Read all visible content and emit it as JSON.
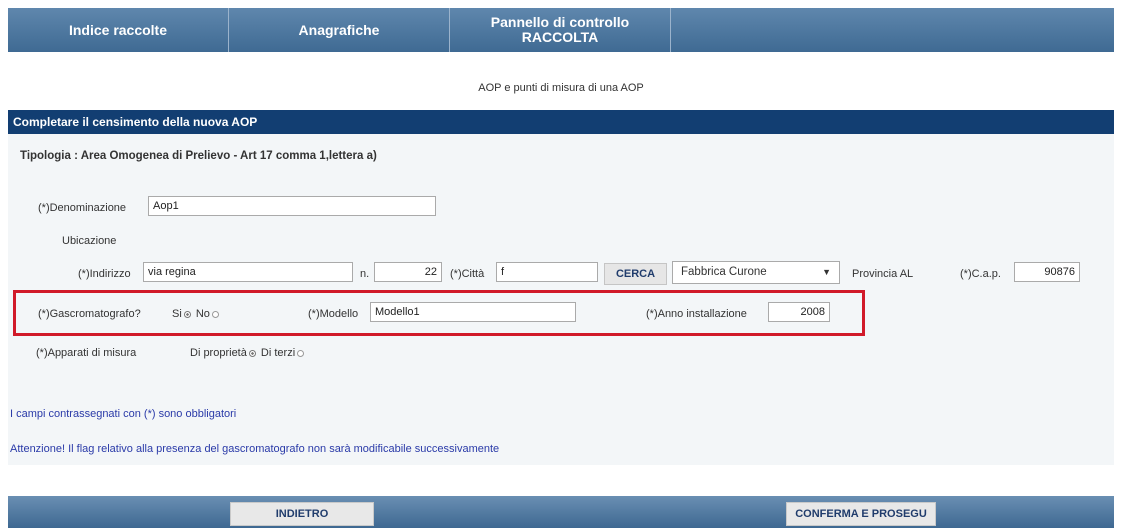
{
  "nav": {
    "tabs": [
      {
        "label": "Indice raccolte"
      },
      {
        "label": "Anagrafiche"
      },
      {
        "label_line1": "Pannello di controllo",
        "label_line2": "RACCOLTA"
      }
    ]
  },
  "page": {
    "subtitle": "AOP e punti di misura di una AOP"
  },
  "form": {
    "header": "Completare il censimento della nuova AOP",
    "tipologia": "Tipologia : Area Omogenea di Prelievo - Art 17 comma 1,lettera a)",
    "denominazione": {
      "label": "(*)Denominazione",
      "value": "Aop1"
    },
    "ubicazione_label": "Ubicazione",
    "indirizzo": {
      "label": "(*)Indirizzo",
      "value": "via regina"
    },
    "numero": {
      "label": "n.",
      "value": "22"
    },
    "citta": {
      "label": "(*)Città",
      "value": "f"
    },
    "cerca_label": "CERCA",
    "comune_select": {
      "value": "Fabbrica Curone"
    },
    "provincia": "Provincia AL",
    "cap": {
      "label": "(*)C.a.p.",
      "value": "90876"
    },
    "gascromatografo": {
      "label": "(*)Gascromatografo?",
      "si": "Si",
      "no": "No",
      "selected": "Si"
    },
    "modello": {
      "label": "(*)Modello",
      "value": "Modello1"
    },
    "anno": {
      "label": "(*)Anno installazione",
      "value": "2008"
    },
    "apparati": {
      "label": "(*)Apparati di misura",
      "proprieta": "Di proprietà",
      "terzi": "Di terzi",
      "selected": "Di proprietà"
    },
    "note_obbligatori": "I campi contrassegnati con (*) sono obbligatori",
    "note_attenzione": "Attenzione! Il flag relativo alla presenza del gascromatografo non sarà modificabile successivamente"
  },
  "footer": {
    "indietro": "INDIETRO",
    "conferma": "CONFERMA E PROSEGU"
  },
  "colors": {
    "nav": "#4f79a2",
    "header": "#123e72",
    "highlight": "#d11a2a",
    "note": "#2a3aa8"
  }
}
